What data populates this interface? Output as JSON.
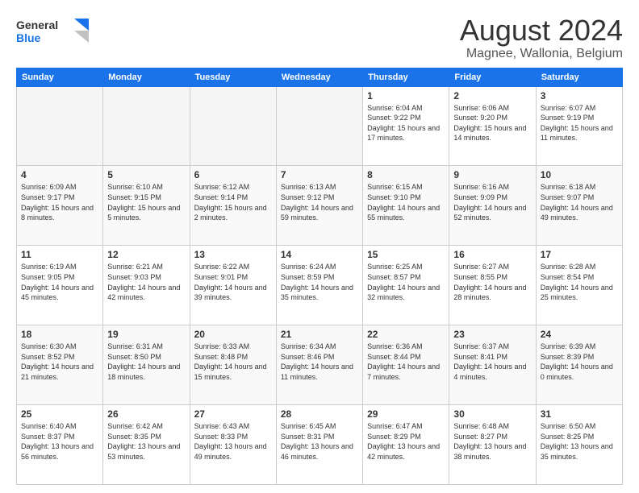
{
  "header": {
    "logo": {
      "line1": "General",
      "line2": "Blue"
    },
    "title": "August 2024",
    "subtitle": "Magnee, Wallonia, Belgium"
  },
  "weekdays": [
    "Sunday",
    "Monday",
    "Tuesday",
    "Wednesday",
    "Thursday",
    "Friday",
    "Saturday"
  ],
  "weeks": [
    [
      {
        "day": "",
        "info": ""
      },
      {
        "day": "",
        "info": ""
      },
      {
        "day": "",
        "info": ""
      },
      {
        "day": "",
        "info": ""
      },
      {
        "day": "1",
        "info": "Sunrise: 6:04 AM\nSunset: 9:22 PM\nDaylight: 15 hours and 17 minutes."
      },
      {
        "day": "2",
        "info": "Sunrise: 6:06 AM\nSunset: 9:20 PM\nDaylight: 15 hours and 14 minutes."
      },
      {
        "day": "3",
        "info": "Sunrise: 6:07 AM\nSunset: 9:19 PM\nDaylight: 15 hours and 11 minutes."
      }
    ],
    [
      {
        "day": "4",
        "info": "Sunrise: 6:09 AM\nSunset: 9:17 PM\nDaylight: 15 hours and 8 minutes."
      },
      {
        "day": "5",
        "info": "Sunrise: 6:10 AM\nSunset: 9:15 PM\nDaylight: 15 hours and 5 minutes."
      },
      {
        "day": "6",
        "info": "Sunrise: 6:12 AM\nSunset: 9:14 PM\nDaylight: 15 hours and 2 minutes."
      },
      {
        "day": "7",
        "info": "Sunrise: 6:13 AM\nSunset: 9:12 PM\nDaylight: 14 hours and 59 minutes."
      },
      {
        "day": "8",
        "info": "Sunrise: 6:15 AM\nSunset: 9:10 PM\nDaylight: 14 hours and 55 minutes."
      },
      {
        "day": "9",
        "info": "Sunrise: 6:16 AM\nSunset: 9:09 PM\nDaylight: 14 hours and 52 minutes."
      },
      {
        "day": "10",
        "info": "Sunrise: 6:18 AM\nSunset: 9:07 PM\nDaylight: 14 hours and 49 minutes."
      }
    ],
    [
      {
        "day": "11",
        "info": "Sunrise: 6:19 AM\nSunset: 9:05 PM\nDaylight: 14 hours and 45 minutes."
      },
      {
        "day": "12",
        "info": "Sunrise: 6:21 AM\nSunset: 9:03 PM\nDaylight: 14 hours and 42 minutes."
      },
      {
        "day": "13",
        "info": "Sunrise: 6:22 AM\nSunset: 9:01 PM\nDaylight: 14 hours and 39 minutes."
      },
      {
        "day": "14",
        "info": "Sunrise: 6:24 AM\nSunset: 8:59 PM\nDaylight: 14 hours and 35 minutes."
      },
      {
        "day": "15",
        "info": "Sunrise: 6:25 AM\nSunset: 8:57 PM\nDaylight: 14 hours and 32 minutes."
      },
      {
        "day": "16",
        "info": "Sunrise: 6:27 AM\nSunset: 8:55 PM\nDaylight: 14 hours and 28 minutes."
      },
      {
        "day": "17",
        "info": "Sunrise: 6:28 AM\nSunset: 8:54 PM\nDaylight: 14 hours and 25 minutes."
      }
    ],
    [
      {
        "day": "18",
        "info": "Sunrise: 6:30 AM\nSunset: 8:52 PM\nDaylight: 14 hours and 21 minutes."
      },
      {
        "day": "19",
        "info": "Sunrise: 6:31 AM\nSunset: 8:50 PM\nDaylight: 14 hours and 18 minutes."
      },
      {
        "day": "20",
        "info": "Sunrise: 6:33 AM\nSunset: 8:48 PM\nDaylight: 14 hours and 15 minutes."
      },
      {
        "day": "21",
        "info": "Sunrise: 6:34 AM\nSunset: 8:46 PM\nDaylight: 14 hours and 11 minutes."
      },
      {
        "day": "22",
        "info": "Sunrise: 6:36 AM\nSunset: 8:44 PM\nDaylight: 14 hours and 7 minutes."
      },
      {
        "day": "23",
        "info": "Sunrise: 6:37 AM\nSunset: 8:41 PM\nDaylight: 14 hours and 4 minutes."
      },
      {
        "day": "24",
        "info": "Sunrise: 6:39 AM\nSunset: 8:39 PM\nDaylight: 14 hours and 0 minutes."
      }
    ],
    [
      {
        "day": "25",
        "info": "Sunrise: 6:40 AM\nSunset: 8:37 PM\nDaylight: 13 hours and 56 minutes."
      },
      {
        "day": "26",
        "info": "Sunrise: 6:42 AM\nSunset: 8:35 PM\nDaylight: 13 hours and 53 minutes."
      },
      {
        "day": "27",
        "info": "Sunrise: 6:43 AM\nSunset: 8:33 PM\nDaylight: 13 hours and 49 minutes."
      },
      {
        "day": "28",
        "info": "Sunrise: 6:45 AM\nSunset: 8:31 PM\nDaylight: 13 hours and 46 minutes."
      },
      {
        "day": "29",
        "info": "Sunrise: 6:47 AM\nSunset: 8:29 PM\nDaylight: 13 hours and 42 minutes."
      },
      {
        "day": "30",
        "info": "Sunrise: 6:48 AM\nSunset: 8:27 PM\nDaylight: 13 hours and 38 minutes."
      },
      {
        "day": "31",
        "info": "Sunrise: 6:50 AM\nSunset: 8:25 PM\nDaylight: 13 hours and 35 minutes."
      }
    ]
  ]
}
